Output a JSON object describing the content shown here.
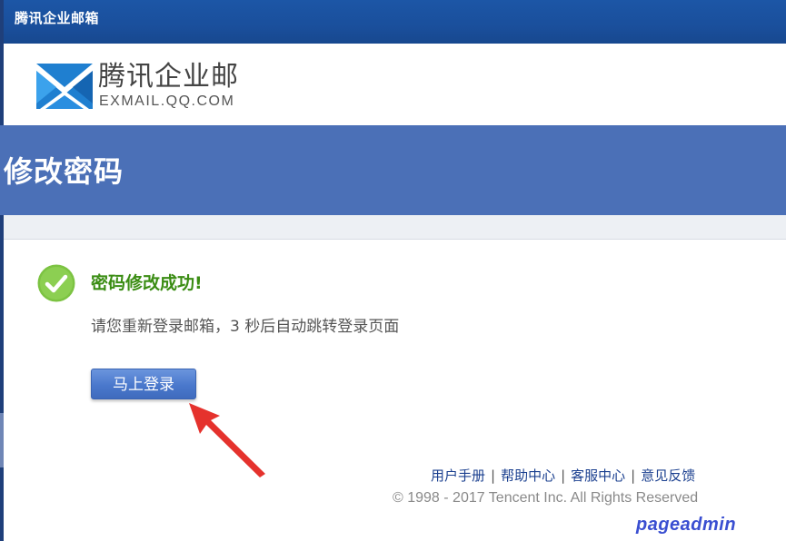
{
  "window": {
    "title": "腾讯企业邮箱"
  },
  "brand": {
    "name_cn": "腾讯企业邮",
    "domain": "EXMAIL.QQ.COM",
    "logo_icon": "envelope-m-logo-icon",
    "logo_colors": [
      "#2c8fd9",
      "#1865b5"
    ]
  },
  "page": {
    "heading": "修改密码"
  },
  "result": {
    "status_icon": "check-circle-icon",
    "status_color": "#7cc342",
    "title": "密码修改成功!",
    "message": "请您重新登录邮箱，3 秒后自动跳转登录页面",
    "login_button_label": "马上登录"
  },
  "annotation": {
    "arrow_icon": "red-arrow-icon",
    "arrow_color": "#e5322d"
  },
  "footer": {
    "links": [
      "用户手册",
      "帮助中心",
      "客服中心",
      "意见反馈"
    ],
    "separator": "|",
    "copyright": "© 1998 - 2017 Tencent Inc. All Rights Reserved"
  },
  "watermark": {
    "text": "pageadmin"
  },
  "colors": {
    "title_bar": "#1a4f9c",
    "band": "#4b70b7",
    "success_text": "#3b8d14",
    "link": "#1a3f8f",
    "button": "#4a78cc"
  }
}
